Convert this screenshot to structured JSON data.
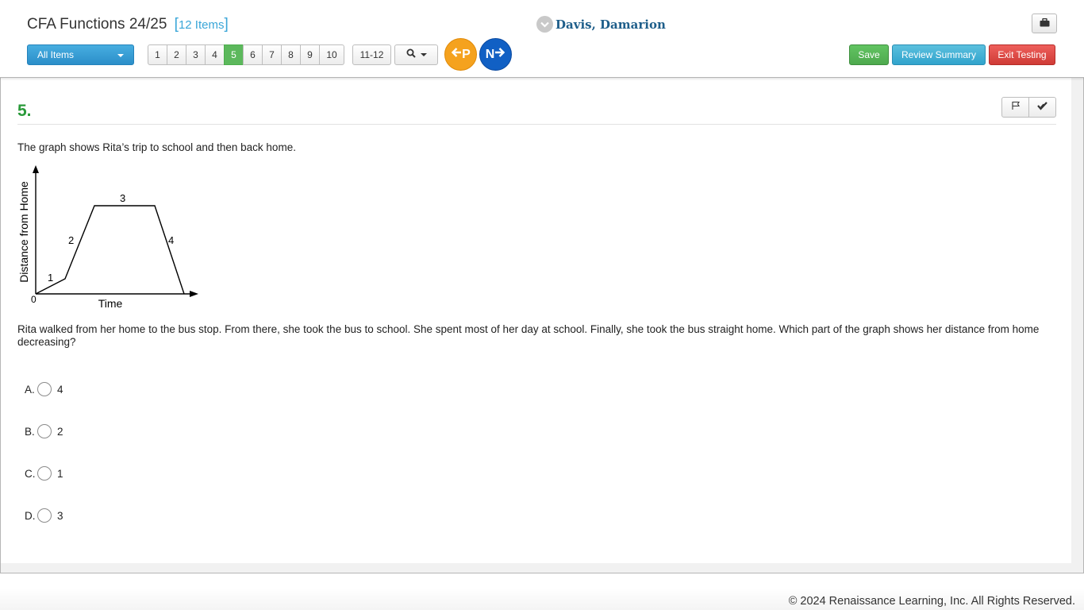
{
  "header": {
    "test_title": "CFA Functions 24/25",
    "item_count_open": "[",
    "item_count": "12 Items",
    "item_count_close": "]",
    "student_name": "Davis, Damarion",
    "tools_icon": "briefcase-icon",
    "filter_dropdown": "All Items",
    "pages": [
      "1",
      "2",
      "3",
      "4",
      "5",
      "6",
      "7",
      "8",
      "9",
      "10"
    ],
    "active_page": "5",
    "range_button": "11-12",
    "search_icon": "search-icon",
    "prev_label": "P",
    "next_label": "N",
    "save_label": "Save",
    "review_label": "Review Summary",
    "exit_label": "Exit Testing"
  },
  "question": {
    "number": "5.",
    "stem": "The graph shows Rita’s trip to school and then back home.",
    "text": "Rita walked from her home to the bus stop. From there, she took the bus to school. She spent most of her day at school. Finally, she took the bus straight home. Which part of the graph shows her distance from home decreasing?",
    "flag_icon": "flag-icon",
    "check_icon": "check-icon"
  },
  "graph": {
    "y_label": "Distance from Home",
    "x_label": "Time",
    "origin_label": "0",
    "segment_labels": [
      "1",
      "2",
      "3",
      "4"
    ]
  },
  "choices": [
    {
      "letter": "A.",
      "text": "4"
    },
    {
      "letter": "B.",
      "text": "2"
    },
    {
      "letter": "C.",
      "text": "1"
    },
    {
      "letter": "D.",
      "text": "3"
    }
  ],
  "footer": {
    "copyright": "© 2024 Renaissance Learning, Inc. All Rights Reserved."
  }
}
